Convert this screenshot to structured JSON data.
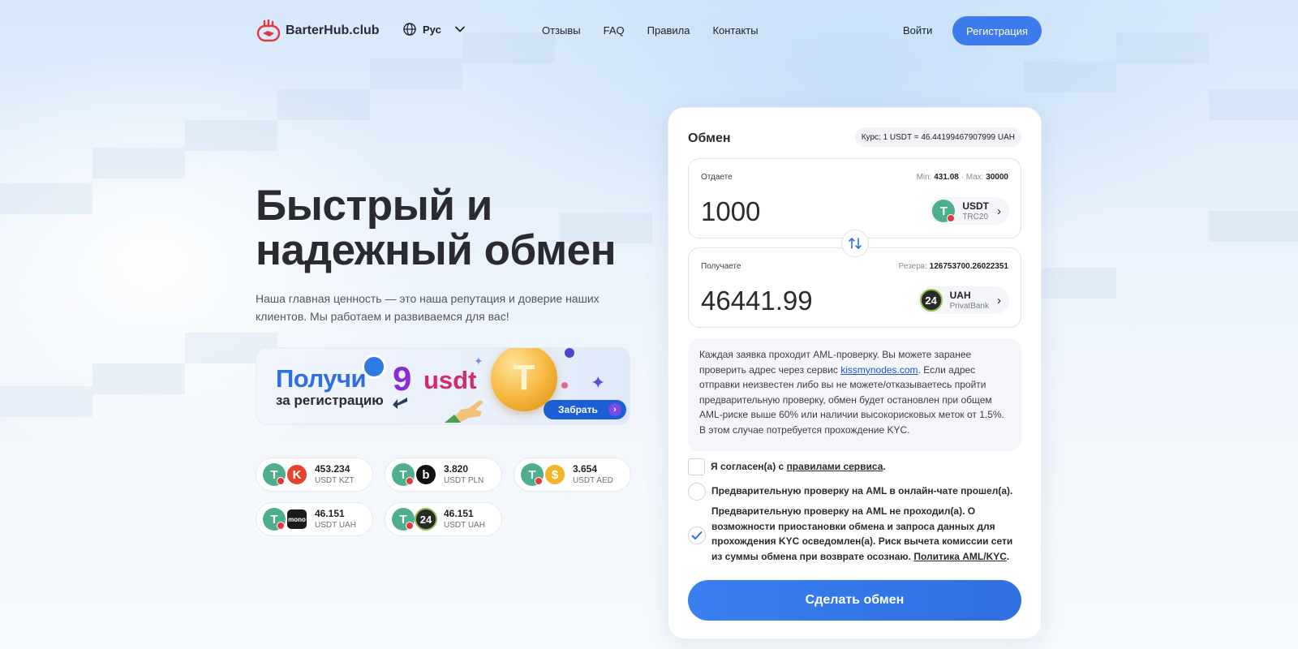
{
  "header": {
    "logo_text": "BarterHub.club",
    "language": "Рус",
    "nav": [
      "Отзывы",
      "FAQ",
      "Правила",
      "Контакты"
    ],
    "login": "Войти",
    "register": "Регистрация"
  },
  "hero": {
    "title_line1": "Быстрый и",
    "title_line2": "надежный обмен",
    "subtitle": "Наша главная ценность — это наша репутация и доверие наших клиентов. Мы работаем и развиваемся для вас!"
  },
  "promo": {
    "get": "Получи",
    "number": "9",
    "currency": "usdt",
    "for_registration": "за регистрацию",
    "button": "Забрать"
  },
  "rates": [
    {
      "value": "453.234",
      "pair": "USDT KZT",
      "icon": "kaspi-icon",
      "color": "#e7432f"
    },
    {
      "value": "3.820",
      "pair": "USDT PLN",
      "icon": "blik-icon",
      "color": "#111111"
    },
    {
      "value": "3.654",
      "pair": "USDT AED",
      "icon": "dirham-coin-icon",
      "color": "#f3b52b"
    },
    {
      "value": "46.151",
      "pair": "USDT UAH",
      "icon": "monobank-icon",
      "color": "#1a1a1a"
    },
    {
      "value": "46.151",
      "pair": "USDT UAH",
      "icon": "privatbank-icon",
      "color": "#2a2a2a"
    }
  ],
  "exchange": {
    "title": "Обмен",
    "rate": "Курс: 1 USDT = 46.44199467907999 UAH",
    "give": {
      "label": "Отдаете",
      "min_label": "Min:",
      "min": "431.08",
      "max_label": "Max:",
      "max": "30000",
      "amount": "1000",
      "currency": "USDT",
      "network": "TRC20"
    },
    "get": {
      "label": "Получаете",
      "reserve_label": "Резерв:",
      "reserve": "126753700.26022351",
      "amount": "46441.99",
      "currency": "UAH",
      "bank": "PrivatBank"
    },
    "aml_text_1": "Каждая заявка проходит AML-проверку. Вы можете заранее проверить адрес через сервис ",
    "aml_link": "kissmynodes.com",
    "aml_text_2": ". Если адрес отправки неизвестен либо вы не можете/отказываетесь пройти предварительную проверку, обмен будет остановлен при общем AML-риске выше 60% или наличии высокорисковых меток от 1.5%. В этом случае потребуется прохождение KYC.",
    "agree_text": "Я согласен(а) с ",
    "agree_link": "правилами сервиса",
    "agree_end": ".",
    "option1": "Предварительную проверку на AML в онлайн-чате прошел(а).",
    "option2": "Предварительную проверку на AML не проходил(а). О возможности приостановки обмена и запроса данных для прохождения KYC осведомлен(а). Риск вычета комиссии сети из суммы обмена при возврате осознаю. ",
    "option2_link": "Политика AML/KYC",
    "option2_end": ".",
    "submit": "Сделать обмен"
  },
  "colors": {
    "accent": "#3d7bec",
    "usdt": "#4fae8d",
    "privat": "#2a2a2a"
  }
}
